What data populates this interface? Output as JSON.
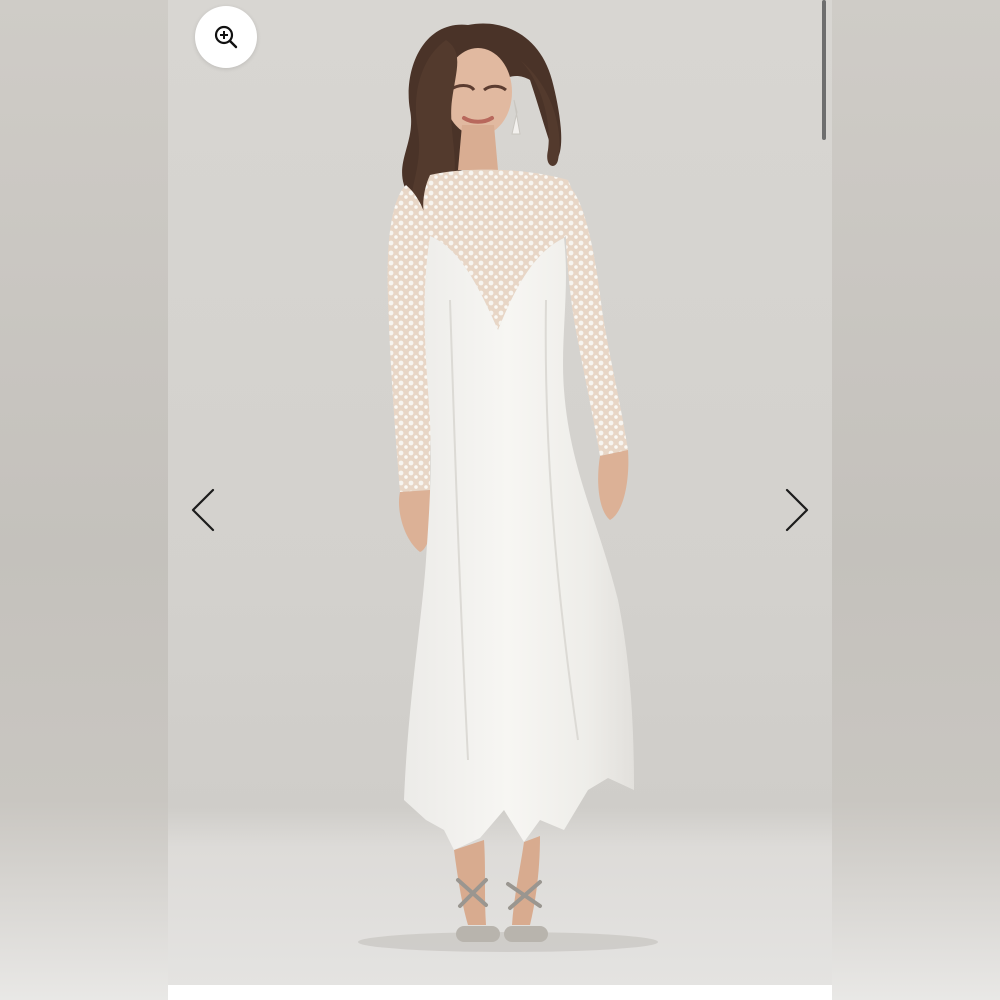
{
  "gallery": {
    "image": {
      "subject_icon": "product-photo",
      "background_color": "#d6d4d0",
      "dress_color": "#f5f3ef"
    },
    "zoom_button": {
      "icon": "zoom-in-icon"
    },
    "prev_button": {
      "icon": "chevron-left-icon"
    },
    "next_button": {
      "icon": "chevron-right-icon"
    }
  }
}
